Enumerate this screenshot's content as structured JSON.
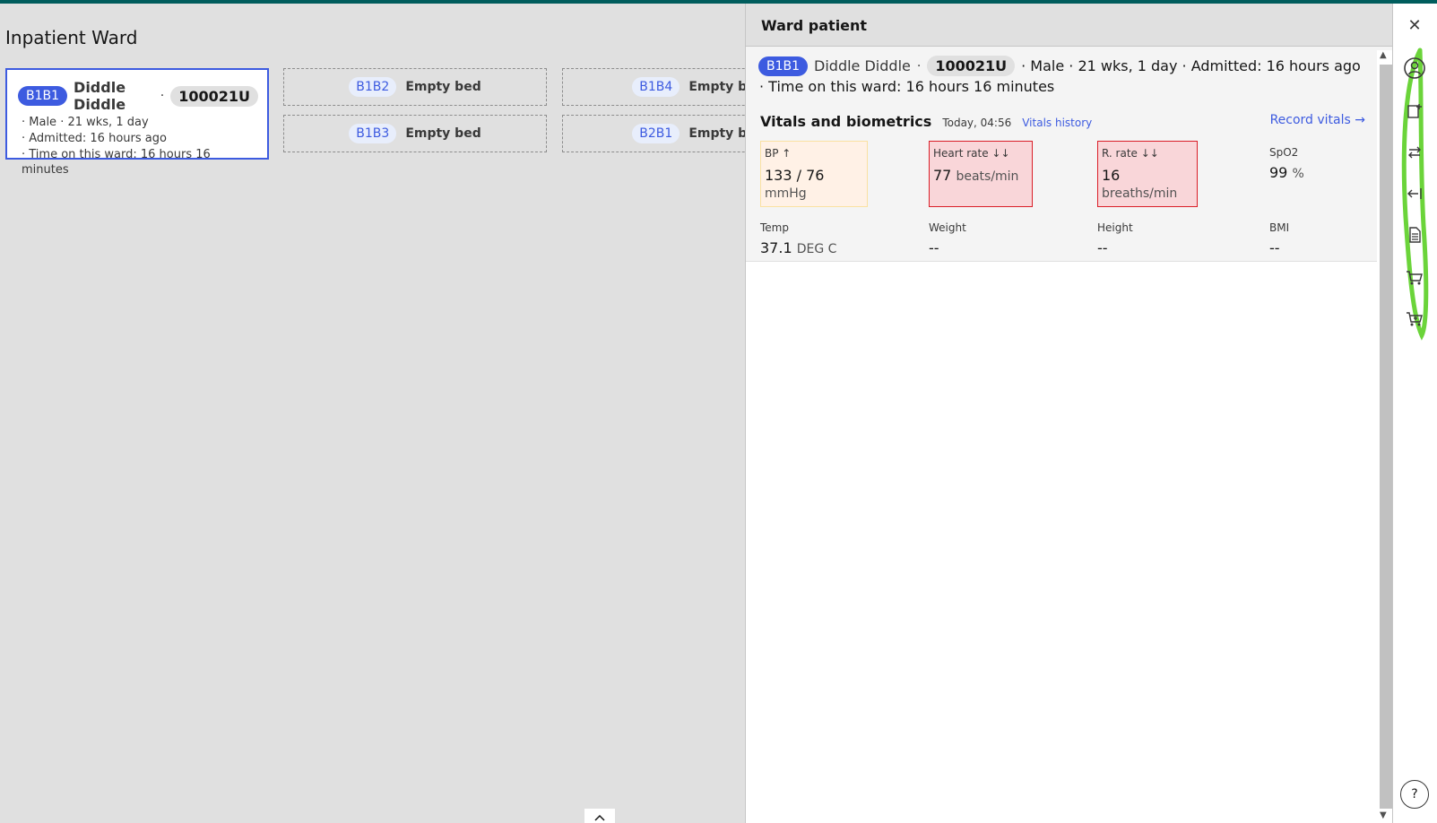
{
  "ward": {
    "title": "Inpatient Ward",
    "occupied_bed": {
      "bed_number": "B1B1",
      "patient_name": "Diddle Diddle",
      "separator": "·",
      "patient_id": "100021U",
      "lines": [
        "· Male · 21 wks, 1 day",
        "· Admitted: 16 hours ago",
        "· Time on this ward: 16 hours 16 minutes"
      ]
    },
    "empty_beds": [
      {
        "bed_number": "B1B2",
        "label": "Empty bed"
      },
      {
        "bed_number": "B1B4",
        "label": "Empty be"
      },
      {
        "bed_number": "B1B3",
        "label": "Empty bed"
      },
      {
        "bed_number": "B2B1",
        "label": "Empty be"
      }
    ],
    "scroll_up_icon": "^"
  },
  "panel": {
    "title": "Ward patient",
    "patient": {
      "bed_number": "B1B1",
      "name": "Diddle Diddle",
      "separator": "·",
      "id": "100021U",
      "meta": "· Male · 21 wks, 1 day · Admitted: 16 hours ago",
      "time_on_ward": "· Time on this ward: 16 hours 16 minutes"
    },
    "vitals": {
      "title": "Vitals and biometrics",
      "timestamp": "Today, 04:56",
      "history_link": "Vitals history",
      "record_link": "Record vitals",
      "record_arrow": "→",
      "items": [
        {
          "label": "BP",
          "flag": "↑",
          "value": "133 / 76",
          "unit": "mmHg",
          "status": "warn"
        },
        {
          "label": "Heart rate",
          "flag": "↓↓",
          "value": "77",
          "unit": "beats/min",
          "status": "crit"
        },
        {
          "label": "R. rate",
          "flag": "↓↓",
          "value": "16",
          "unit": "breaths/min",
          "status": "crit"
        },
        {
          "label": "SpO2",
          "flag": "",
          "value": "99",
          "unit": "%",
          "status": "normal"
        },
        {
          "label": "Temp",
          "flag": "",
          "value": "37.1",
          "unit": "DEG C",
          "status": "normal"
        },
        {
          "label": "Weight",
          "flag": "",
          "value": "--",
          "unit": "",
          "status": "normal"
        },
        {
          "label": "Height",
          "flag": "",
          "value": "--",
          "unit": "",
          "status": "normal"
        },
        {
          "label": "BMI",
          "flag": "",
          "value": "--",
          "unit": "",
          "status": "normal"
        }
      ]
    }
  },
  "side_nav": {
    "close_icon": "✕",
    "icons": [
      "patient-summary-icon",
      "add-note-icon",
      "transfer-icon",
      "discharge-icon",
      "document-icon",
      "cart-icon",
      "cart-add-icon"
    ],
    "help_icon": "?",
    "annotation_color": "#6bd43a"
  },
  "colors": {
    "accent": "#3d5be0",
    "critical": "#da1e28",
    "top_bar": "#005d5d"
  }
}
